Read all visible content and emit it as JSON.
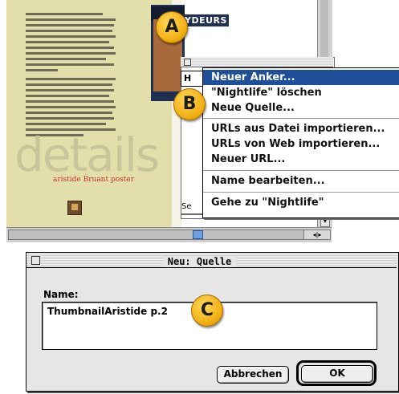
{
  "document_window": {
    "big_word": "details",
    "caption": "aristide Bruant poster",
    "poster_text": "YDEURS",
    "scroll_arrows": "◂|▸"
  },
  "bookmarks_panel": {
    "row_label": "H",
    "footer_label": "Se"
  },
  "context_menu": {
    "items": [
      "Neuer Anker...",
      "\"Nightlife\" löschen",
      "Neue Quelle...",
      "URLs aus Datei importieren...",
      "URLs von Web importieren...",
      "Neuer URL...",
      "Name bearbeiten...",
      "Gehe zu \"Nightlife\""
    ],
    "highlighted_index": 0
  },
  "callouts": {
    "a": "A",
    "b": "B",
    "c": "C"
  },
  "dialog": {
    "title": "Neu: Quelle",
    "name_label": "Name:",
    "name_value": "ThumbnailAristide p.2",
    "cancel_label": "Abbrechen",
    "ok_label": "OK"
  },
  "colors": {
    "page_background": "#e2dfab",
    "menu_highlight": "#1f4f98",
    "caption_red": "#c7332b",
    "callout_gold": "#f3b216"
  }
}
